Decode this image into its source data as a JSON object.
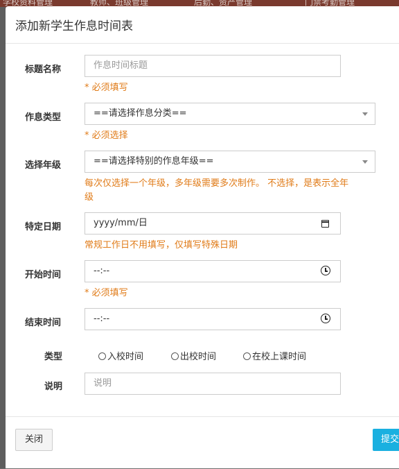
{
  "background": {
    "nav_items": [
      "学校资料管理",
      "教师、班级管理",
      "后勤、资产管理",
      "门禁考勤管理"
    ]
  },
  "modal": {
    "title": "添加新学生作息时间表",
    "fields": {
      "title": {
        "label": "标题名称",
        "placeholder": "作息时间标题",
        "hint": "* 必须填写"
      },
      "type": {
        "label": "作息类型",
        "value": "==请选择作息分类==",
        "hint": "* 必须选择"
      },
      "grade": {
        "label": "选择年级",
        "value": "==请选择特别的作息年级==",
        "hint_line1": "每次仅选择一个年级，多年级需要多次制作。 不选择，是表示全年",
        "hint_line2": "级"
      },
      "date": {
        "label": "特定日期",
        "value": "yyyy/mm/日",
        "hint": "常规工作日不用填写，仅填写特殊日期"
      },
      "start": {
        "label": "开始时间",
        "value": "--:--",
        "hint": "* 必须填写"
      },
      "end": {
        "label": "结束时间",
        "value": "--:--"
      },
      "kind": {
        "label": "类型",
        "options": [
          "入校时间",
          "出校时间",
          "在校上课时间"
        ]
      },
      "note": {
        "label": "说明",
        "placeholder": "说明"
      }
    },
    "buttons": {
      "close": "关闭",
      "submit": "提交"
    }
  },
  "colors": {
    "hint": "#e07b18",
    "submit": "#1ab0e0"
  }
}
